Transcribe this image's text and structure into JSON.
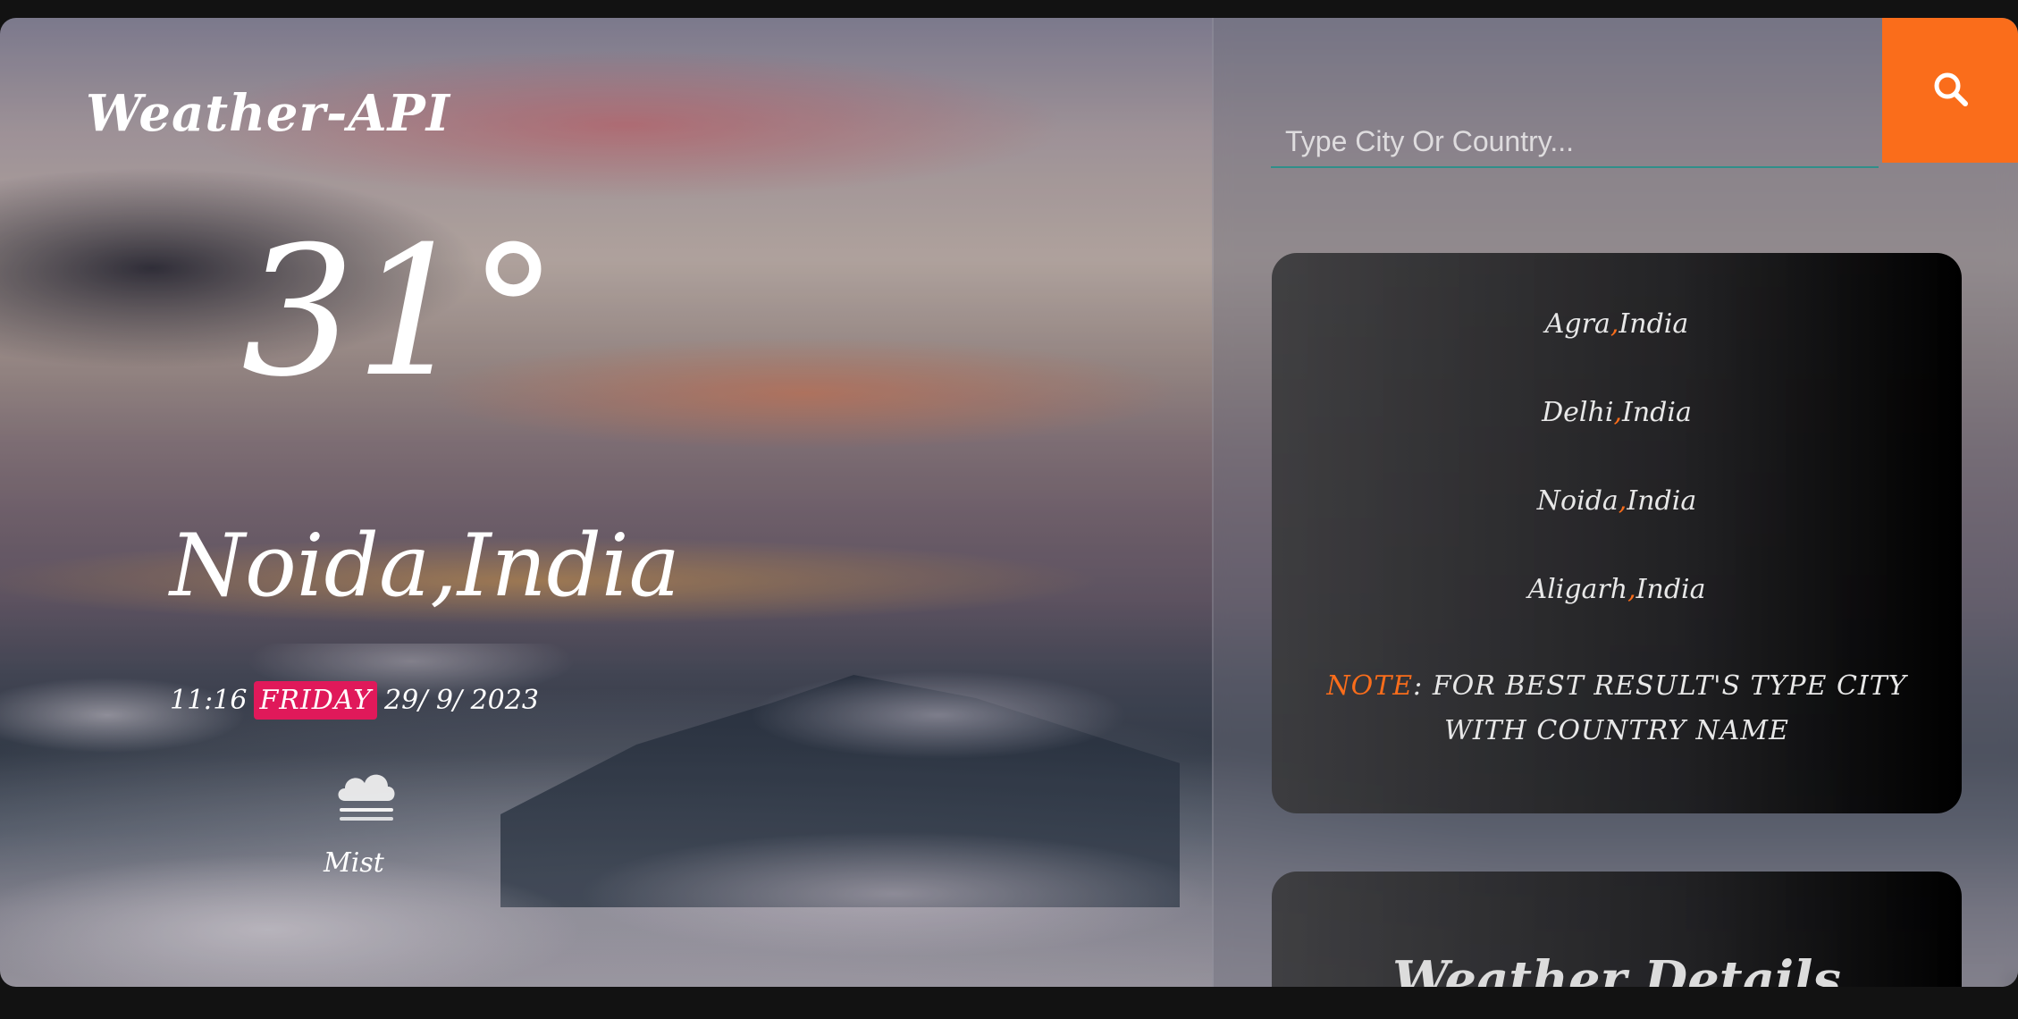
{
  "app": {
    "title": "Weather-API"
  },
  "current": {
    "temperature": "31°",
    "location": "Noida,India",
    "time": "11:16",
    "day": "FRIDAY",
    "date": "29/ 9/ 2023",
    "condition": "Mist",
    "condition_icon": "mist-cloud-icon"
  },
  "search": {
    "placeholder": "Type City Or Country...",
    "value": "",
    "button_icon": "search-icon"
  },
  "cities": [
    {
      "city": "Agra",
      "sep": ",",
      "country": "India"
    },
    {
      "city": "Delhi",
      "sep": ",",
      "country": "India"
    },
    {
      "city": "Noida",
      "sep": ",",
      "country": "India"
    },
    {
      "city": "Aligarh",
      "sep": ",",
      "country": "India"
    }
  ],
  "note": {
    "label": "NOTE",
    "text": ": FOR BEST RESULT'S TYPE CITY WITH COUNTRY NAME"
  },
  "details": {
    "title": "Weather Details"
  },
  "colors": {
    "accent": "#fa6d1b",
    "day_badge": "#e0195a",
    "search_underline": "#2f8f8a"
  }
}
